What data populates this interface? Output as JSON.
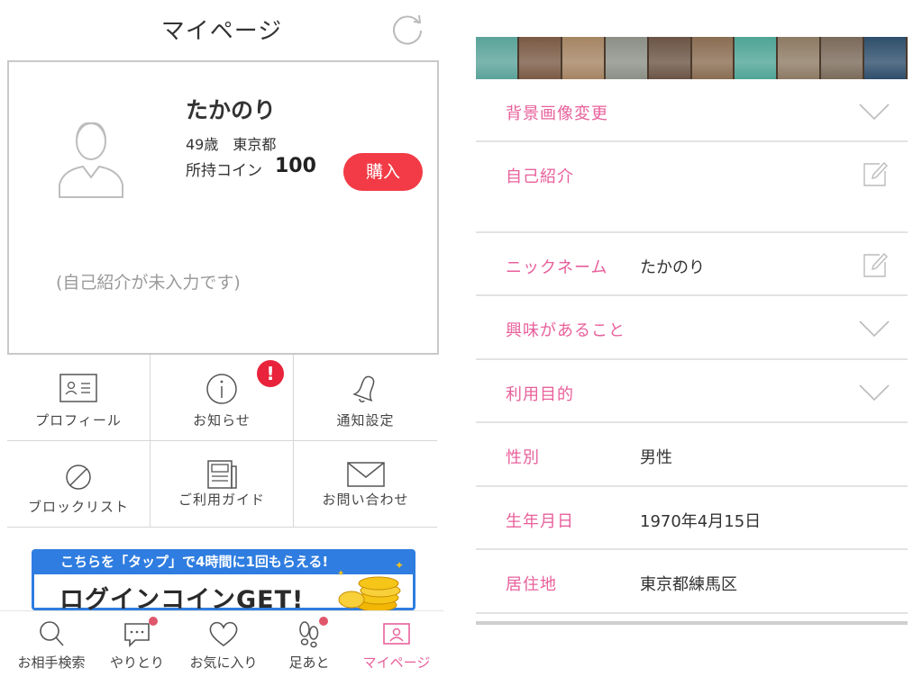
{
  "left": {
    "header": {
      "title": "マイページ",
      "refresh_icon": "refresh-icon"
    },
    "profile": {
      "nickname": "たかのり",
      "age_area": "49歳　東京都",
      "coin_label": "所持コイン",
      "coin_value": "100",
      "buy_label": "購入",
      "intro_placeholder": "(自己紹介が未入力です)",
      "avatar_icon": "person-avatar-icon"
    },
    "menu": [
      {
        "label": "プロフィール",
        "icon": "profile-card-icon"
      },
      {
        "label": "お知らせ",
        "icon": "info-icon",
        "badge": "!"
      },
      {
        "label": "通知設定",
        "icon": "bell-icon"
      },
      {
        "label": "ブロックリスト",
        "icon": "block-icon"
      },
      {
        "label": "ご利用ガイド",
        "icon": "guide-icon"
      },
      {
        "label": "お問い合わせ",
        "icon": "mail-icon"
      }
    ],
    "banner": {
      "top_text": "こちらを「タップ」で4時間に1回もらえる!",
      "main_text": "ログインコインGET!"
    },
    "tabs": [
      {
        "label": "お相手検索",
        "icon": "search-icon"
      },
      {
        "label": "やりとり",
        "icon": "chat-icon"
      },
      {
        "label": "お気に入り",
        "icon": "heart-icon"
      },
      {
        "label": "足あと",
        "icon": "footprint-icon"
      },
      {
        "label": "マイページ",
        "icon": "mypage-icon",
        "active": true
      }
    ],
    "colors": {
      "accent_pink": "#e8609b",
      "buy_red": "#f23b46",
      "banner_blue": "#2f7de0"
    }
  },
  "right": {
    "rows": [
      {
        "label": "背景画像変更",
        "value": "",
        "control": "chevron-down-icon"
      },
      {
        "label": "自己紹介",
        "value": "",
        "control": "edit-icon"
      },
      {
        "label": "ニックネーム",
        "value": "たかのり",
        "control": "edit-icon"
      },
      {
        "label": "興味があること",
        "value": "",
        "control": "chevron-down-icon"
      },
      {
        "label": "利用目的",
        "value": "",
        "control": "chevron-down-icon"
      },
      {
        "label": "性別",
        "value": "男性"
      },
      {
        "label": "生年月日",
        "value": "1970年4月15日"
      },
      {
        "label": "居住地",
        "value": "東京都練馬区"
      }
    ],
    "wood_colors": [
      "#5aa39a",
      "#7a5a44",
      "#a58463",
      "#8c8f86",
      "#6b5444",
      "#8a6d52",
      "#4fa596",
      "#8d7a64",
      "#7a6a5a",
      "#2e4e6b"
    ]
  }
}
